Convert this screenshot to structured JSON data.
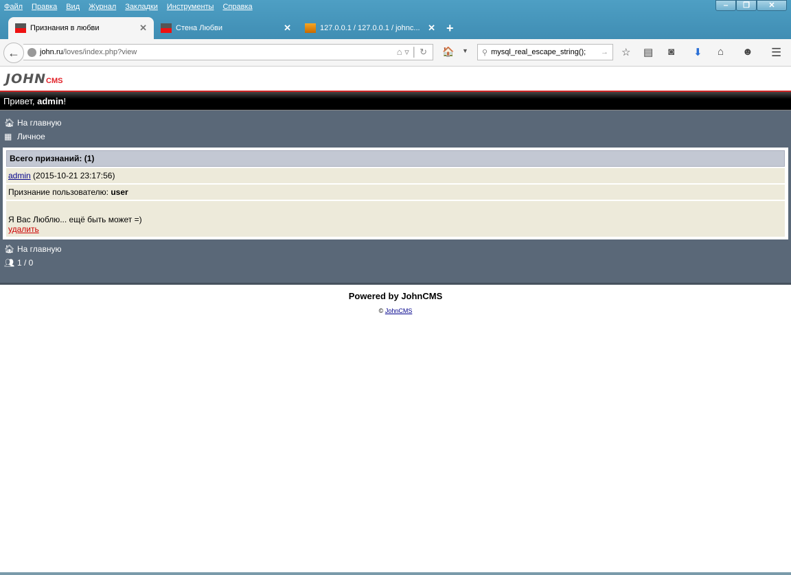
{
  "browser": {
    "menu": [
      "Файл",
      "Правка",
      "Вид",
      "Журнал",
      "Закладки",
      "Инструменты",
      "Справка"
    ],
    "tabs": [
      {
        "title": "Признания в любви",
        "active": true
      },
      {
        "title": "Стена Любви"
      },
      {
        "title": "127.0.0.1 / 127.0.0.1 / johnc..."
      }
    ],
    "url_domain": "john.ru",
    "url_path": "/loves/index.php?view",
    "search_value": "mysql_real_escape_string();"
  },
  "page": {
    "logo_john": "JOHN",
    "logo_cms": "CMS",
    "greeting_prefix": "Привет, ",
    "greeting_user": "admin",
    "greeting_suffix": "!",
    "nav_top": [
      {
        "label": "На главную",
        "icon": "home-icon"
      },
      {
        "label": "Личное",
        "icon": "grid-icon"
      }
    ],
    "list_header": "Всего признаний: (1)",
    "entry": {
      "author": "admin",
      "date": "(2015-10-21 23:17:56)",
      "to_label": "Признание пользователю: ",
      "to_user": "user",
      "message": "Я Вас Люблю... ещё быть может =)",
      "delete": "удалить"
    },
    "nav_bottom": [
      {
        "label": "На главную",
        "icon": "home-icon"
      },
      {
        "label": "1 / 0",
        "icon": "users-icon"
      }
    ],
    "powered": "Powered by JohnCMS",
    "copyright_symbol": "©",
    "copyright_link": "JohnCMS"
  }
}
